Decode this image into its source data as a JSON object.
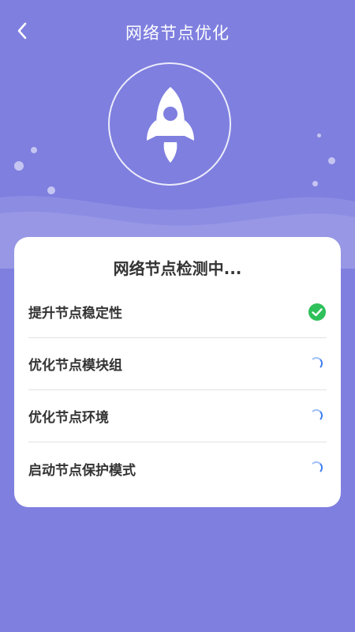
{
  "header": {
    "title": "网络节点优化"
  },
  "card": {
    "title": "网络节点检测中...",
    "items": [
      {
        "label": "提升节点稳定性",
        "status": "done"
      },
      {
        "label": "优化节点模块组",
        "status": "loading"
      },
      {
        "label": "优化节点环境",
        "status": "loading"
      },
      {
        "label": "启动节点保护模式",
        "status": "loading"
      }
    ]
  },
  "colors": {
    "background": "#7f7fe0",
    "success": "#2ec05a",
    "spinner": "#3b7cf0"
  },
  "icons": {
    "back": "chevron-left-icon",
    "hero": "rocket-icon",
    "done": "check-circle-icon",
    "loading": "spinner-icon"
  }
}
